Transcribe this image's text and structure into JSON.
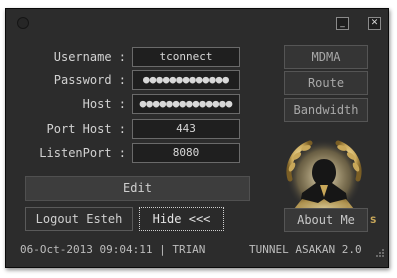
{
  "window": {
    "close_glyph": "✕",
    "minimize_glyph": "_"
  },
  "form": {
    "username_label": "Username :",
    "username_value": "tconnect",
    "password_label": "Password :",
    "password_value": "●●●●●●●●●●●●●",
    "host_label": "Host :",
    "host_value": "●●●●●●●●●●●●●●",
    "port_host_label": "Port Host :",
    "port_host_value": "443",
    "listen_port_label": "ListenPort :",
    "listen_port_value": "8080"
  },
  "side_buttons": {
    "mdma": "MDMA",
    "route": "Route",
    "bandwidth": "Bandwidth",
    "about": "About Me"
  },
  "actions": {
    "edit": "Edit",
    "logout": "Logout Esteh",
    "hide": "Hide <<<"
  },
  "status": {
    "datetime_user": "06-Oct-2013 09:04:11 | TRIAN",
    "app_name": "TUNNEL ASAKAN 2.0"
  },
  "logo": {
    "icon": "laurel-emblem-icon",
    "colors": {
      "gold": "#c9a85a",
      "dark": "#1a1a1a"
    }
  }
}
